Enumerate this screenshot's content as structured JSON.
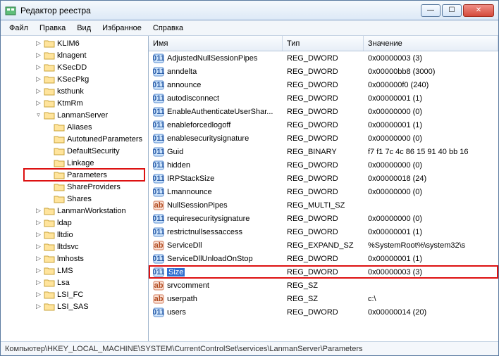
{
  "titlebar": {
    "title": "Редактор реестра"
  },
  "menu": [
    "Файл",
    "Правка",
    "Вид",
    "Избранное",
    "Справка"
  ],
  "tree": [
    {
      "indent": 3,
      "toggle": "▷",
      "label": "KLIM6"
    },
    {
      "indent": 3,
      "toggle": "▷",
      "label": "klnagent"
    },
    {
      "indent": 3,
      "toggle": "▷",
      "label": "KSecDD"
    },
    {
      "indent": 3,
      "toggle": "▷",
      "label": "KSecPkg"
    },
    {
      "indent": 3,
      "toggle": "▷",
      "label": "ksthunk"
    },
    {
      "indent": 3,
      "toggle": "▷",
      "label": "KtmRm"
    },
    {
      "indent": 3,
      "toggle": "▿",
      "label": "LanmanServer"
    },
    {
      "indent": 4,
      "toggle": "",
      "label": "Aliases"
    },
    {
      "indent": 4,
      "toggle": "",
      "label": "AutotunedParameters"
    },
    {
      "indent": 4,
      "toggle": "",
      "label": "DefaultSecurity"
    },
    {
      "indent": 4,
      "toggle": "",
      "label": "Linkage"
    },
    {
      "indent": 4,
      "toggle": "",
      "label": "Parameters",
      "highlight": true
    },
    {
      "indent": 4,
      "toggle": "",
      "label": "ShareProviders"
    },
    {
      "indent": 4,
      "toggle": "",
      "label": "Shares"
    },
    {
      "indent": 3,
      "toggle": "▷",
      "label": "LanmanWorkstation"
    },
    {
      "indent": 3,
      "toggle": "▷",
      "label": "ldap"
    },
    {
      "indent": 3,
      "toggle": "▷",
      "label": "lltdio"
    },
    {
      "indent": 3,
      "toggle": "▷",
      "label": "lltdsvc"
    },
    {
      "indent": 3,
      "toggle": "▷",
      "label": "lmhosts"
    },
    {
      "indent": 3,
      "toggle": "▷",
      "label": "LMS"
    },
    {
      "indent": 3,
      "toggle": "▷",
      "label": "Lsa"
    },
    {
      "indent": 3,
      "toggle": "▷",
      "label": "LSI_FC"
    },
    {
      "indent": 3,
      "toggle": "▷",
      "label": "LSI_SAS"
    }
  ],
  "columns": {
    "name": "Имя",
    "type": "Тип",
    "data": "Значение"
  },
  "rows": [
    {
      "icon": "dword",
      "name": "AdjustedNullSessionPipes",
      "type": "REG_DWORD",
      "data": "0x00000003 (3)"
    },
    {
      "icon": "dword",
      "name": "anndelta",
      "type": "REG_DWORD",
      "data": "0x00000bb8 (3000)"
    },
    {
      "icon": "dword",
      "name": "announce",
      "type": "REG_DWORD",
      "data": "0x000000f0 (240)"
    },
    {
      "icon": "dword",
      "name": "autodisconnect",
      "type": "REG_DWORD",
      "data": "0x00000001 (1)"
    },
    {
      "icon": "dword",
      "name": "EnableAuthenticateUserShar...",
      "type": "REG_DWORD",
      "data": "0x00000000 (0)"
    },
    {
      "icon": "dword",
      "name": "enableforcedlogoff",
      "type": "REG_DWORD",
      "data": "0x00000001 (1)"
    },
    {
      "icon": "dword",
      "name": "enablesecuritysignature",
      "type": "REG_DWORD",
      "data": "0x00000000 (0)"
    },
    {
      "icon": "dword",
      "name": "Guid",
      "type": "REG_BINARY",
      "data": "f7 f1 7c 4c 86 15 91 40 bb 16"
    },
    {
      "icon": "dword",
      "name": "hidden",
      "type": "REG_DWORD",
      "data": "0x00000000 (0)"
    },
    {
      "icon": "dword",
      "name": "IRPStackSize",
      "type": "REG_DWORD",
      "data": "0x00000018 (24)"
    },
    {
      "icon": "dword",
      "name": "Lmannounce",
      "type": "REG_DWORD",
      "data": "0x00000000 (0)"
    },
    {
      "icon": "sz",
      "name": "NullSessionPipes",
      "type": "REG_MULTI_SZ",
      "data": ""
    },
    {
      "icon": "dword",
      "name": "requiresecuritysignature",
      "type": "REG_DWORD",
      "data": "0x00000000 (0)"
    },
    {
      "icon": "dword",
      "name": "restrictnullsessaccess",
      "type": "REG_DWORD",
      "data": "0x00000001 (1)"
    },
    {
      "icon": "sz",
      "name": "ServiceDll",
      "type": "REG_EXPAND_SZ",
      "data": "%SystemRoot%\\system32\\s"
    },
    {
      "icon": "dword",
      "name": "ServiceDllUnloadOnStop",
      "type": "REG_DWORD",
      "data": "0x00000001 (1)"
    },
    {
      "icon": "dword",
      "name": "Size",
      "type": "REG_DWORD",
      "data": "0x00000003 (3)",
      "selected": true,
      "highlight": true
    },
    {
      "icon": "sz",
      "name": "srvcomment",
      "type": "REG_SZ",
      "data": ""
    },
    {
      "icon": "sz",
      "name": "userpath",
      "type": "REG_SZ",
      "data": "c:\\"
    },
    {
      "icon": "dword",
      "name": "users",
      "type": "REG_DWORD",
      "data": "0x00000014 (20)"
    }
  ],
  "statusbar": "Компьютер\\HKEY_LOCAL_MACHINE\\SYSTEM\\CurrentControlSet\\services\\LanmanServer\\Parameters"
}
